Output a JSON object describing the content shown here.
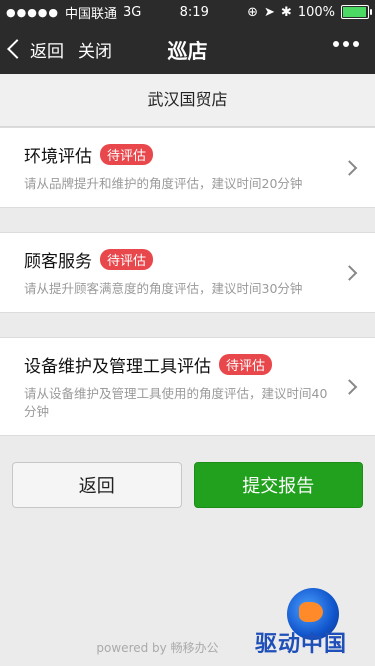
{
  "status": {
    "carrier": "中国联通",
    "network": "3G",
    "time": "8:19",
    "battery": "100%",
    "battery_level": 1.0
  },
  "nav": {
    "back_label": "返回",
    "close_label": "关闭",
    "title": "巡店"
  },
  "store": {
    "name": "武汉国贸店"
  },
  "items": [
    {
      "name": "环境评估",
      "badge": "待评估",
      "desc": "请从品牌提升和维护的角度评估，建议时间20分钟"
    },
    {
      "name": "顾客服务",
      "badge": "待评估",
      "desc": "请从提升顾客满意度的角度评估，建议时间30分钟"
    },
    {
      "name": "设备维护及管理工具评估",
      "badge": "待评估",
      "desc": "请从设备维护及管理工具使用的角度评估，建议时间40分钟"
    }
  ],
  "buttons": {
    "back": "返回",
    "submit": "提交报告"
  },
  "footer": {
    "powered": "powered by 畅移办公"
  },
  "watermark": {
    "text": "驱动中国"
  },
  "colors": {
    "badge": "#e8484c",
    "submit": "#22a11e",
    "topbar": "#2b2b2b"
  }
}
